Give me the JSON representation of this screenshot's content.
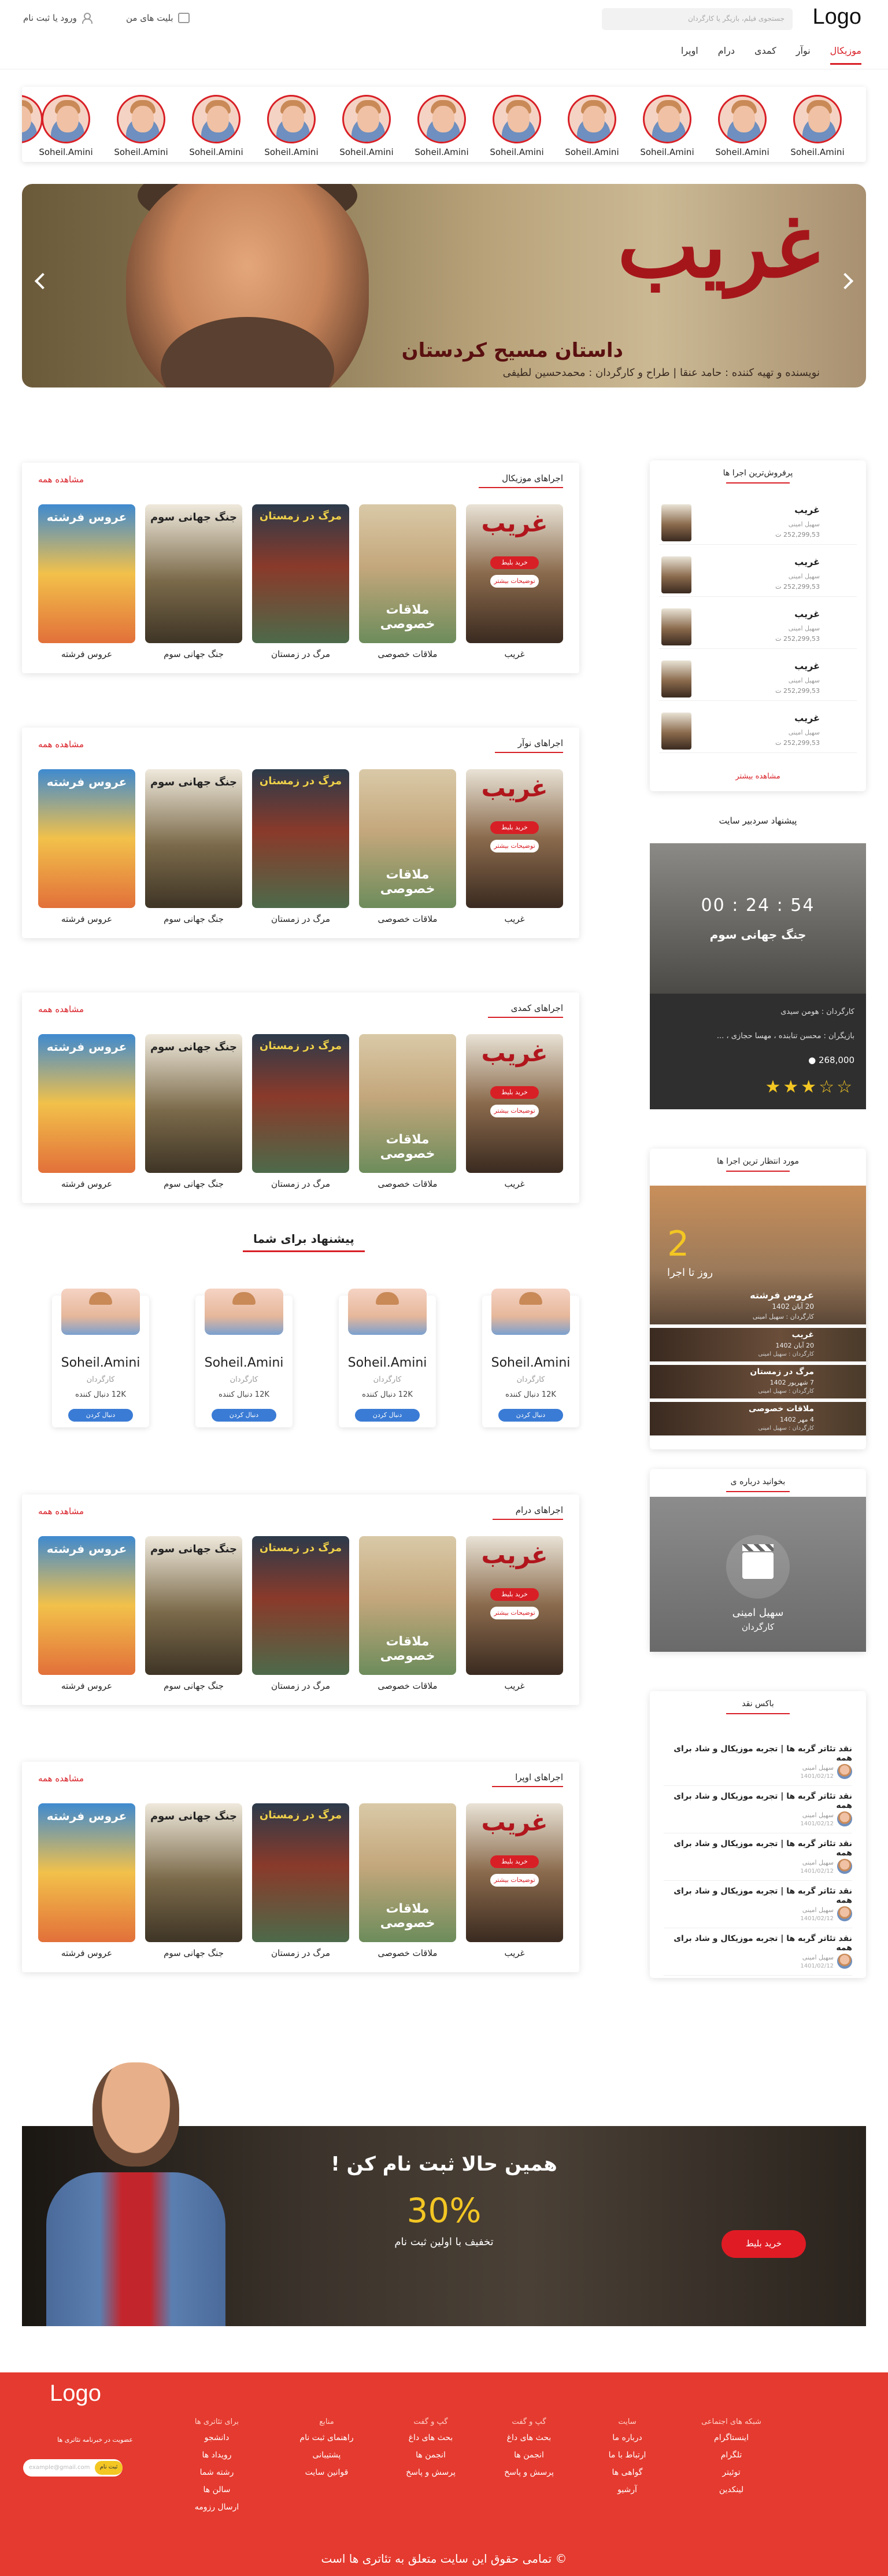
{
  "header": {
    "logo": "Logo",
    "search_placeholder": "جستجوی فیلم، بازیگر یا کارگردان",
    "login": "ورود یا ثبت نام",
    "my_tickets": "بلیت های من",
    "nav": [
      "موزیکال",
      "نوآر",
      "کمدی",
      "درام",
      "اوپرا"
    ]
  },
  "people": {
    "name": "Soheil.Amini",
    "count": 11
  },
  "banner": {
    "title": "غریب",
    "subtitle": "داستان مسیح کردستان",
    "credit": "نویسنده و تهیه کننده : حامد عنقا | طراح و کارگردان : محمدحسین لطیفی"
  },
  "sections": [
    {
      "title": "اجراهای موزیکال",
      "see_all": "مشاهده همه"
    },
    {
      "title": "اجراهای نوآر",
      "see_all": "مشاهده همه"
    },
    {
      "title": "اجراهای کمدی",
      "see_all": "مشاهده همه"
    },
    {
      "title": "اجراهای درام",
      "see_all": "مشاهده همه"
    },
    {
      "title": "اجراهای اوپرا",
      "see_all": "مشاهده همه"
    }
  ],
  "posters": [
    "غریب",
    "ملاقات خصوصی",
    "مرگ در زمستان",
    "جنگ جهانی سوم",
    "عروس فرشته"
  ],
  "poster_buttons": {
    "buy": "خرید بلیط",
    "more": "توضیحات بیشتر"
  },
  "suggestions": {
    "title": "پیشنهاد برای شما",
    "name": "Soheil.Amini",
    "role": "کارگردان",
    "followers": "12K دنبال کننده",
    "follow": "دنبال کردن"
  },
  "bestsellers": {
    "title": "پرفروش‌ترین اجرا ها",
    "item_name": "غریب",
    "item_sub": "سهیل امینی",
    "item_price": "252,299,53 ت",
    "more": "مشاهده بیشتر"
  },
  "admin_pick": {
    "title": "پیشنهاد سردبیر سایت",
    "timer": "00 : 24 : 54",
    "movie": "جنگ جهانی سوم",
    "director": "کارگردان : هومن سیدی",
    "cast": "بازیگران : محسن تنابنده ، مهسا حجازی ، ...",
    "views": "268,000",
    "stars": "★★★☆☆"
  },
  "awaited": {
    "title": "مورد انتظار ترین اجرا ها",
    "num": "2",
    "days": "روز تا اجرا",
    "main_title": "عروس فرشته",
    "main_date": "20 آبان 1402",
    "main_dir": "کارگردان : سهیل امینی",
    "rows": [
      {
        "title": "غریب",
        "date": "20 آبان 1402",
        "dir": "کارگردان : سهیل امینی"
      },
      {
        "title": "مرگ در زمستان",
        "date": "7 شهریور 1402",
        "dir": "کارگردان : سهیل امینی"
      },
      {
        "title": "ملاقات خصوصی",
        "date": "4 مهر 1402",
        "dir": "کارگردان : سهیل امینی"
      }
    ]
  },
  "intro": {
    "title": "بخوانید درباره ی",
    "name": "سهیل امینی",
    "role": "کارگردان"
  },
  "critic": {
    "title": "باکس نقد",
    "text": "نقد تئاتر گربه ها | تجربه موزیکال و شاد برای همه",
    "who": "سهیل امینی",
    "date": "1401/02/12"
  },
  "signup": {
    "title": "همین حالا ثبت نام کن !",
    "percent": "30%",
    "sub": "تخفیف با اولین ثبت نام",
    "button": "خرید بلیط"
  },
  "footer": {
    "logo": "Logo",
    "newsletter": "عضویت در خبرنامه تئاتری ها",
    "email_placeholder": "example@gmail.com",
    "submit": "ثبت نام",
    "columns": [
      {
        "head": "شبکه های اجتماعی",
        "items": [
          "اینستاگرام",
          "تلگرام",
          "توئیتر",
          "لینکدین"
        ]
      },
      {
        "head": "سایت",
        "items": [
          "درباره ما",
          "ارتباط با ما",
          "گواهی ها",
          "آرشیو"
        ]
      },
      {
        "head": "گپ و گفت",
        "items": [
          "بحث های داغ",
          "انجمن ها",
          "پرسش و پاسخ"
        ]
      },
      {
        "head": "گپ و گفت",
        "items": [
          "بحث های داغ",
          "انجمن ها",
          "پرسش و پاسخ"
        ]
      },
      {
        "head": "منابع",
        "items": [
          "راهنمای ثبت نام",
          "پشتیبانی",
          "قوانین سایت"
        ]
      },
      {
        "head": "برای تئاتری ها",
        "items": [
          "دانشجو",
          "رویداد ها",
          "رشته شما",
          "سالن ها",
          "ارسال رزومه"
        ]
      }
    ],
    "copyright": "© تمامی حقوق این سایت متعلق به تئاتری ها است"
  }
}
